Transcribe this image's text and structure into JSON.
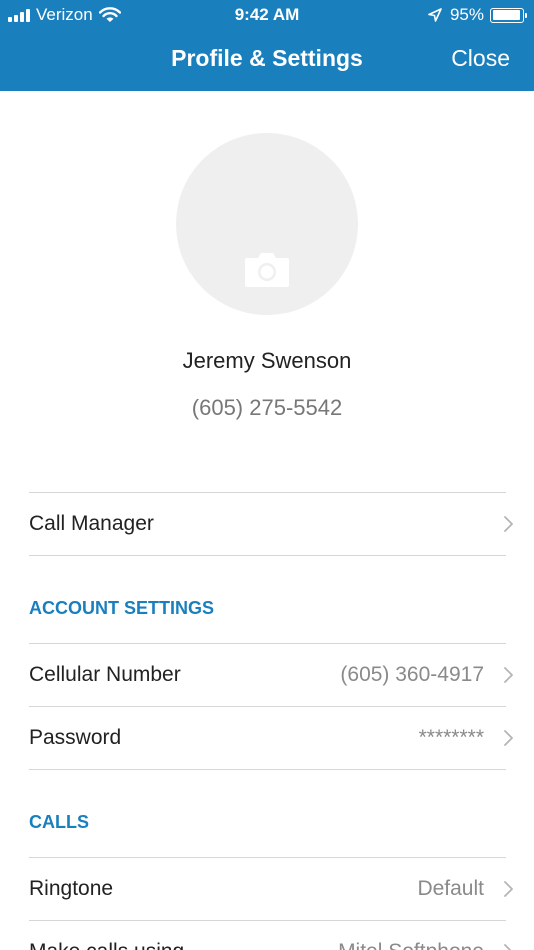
{
  "status_bar": {
    "carrier": "Verizon",
    "time": "9:42 AM",
    "battery": "95%",
    "battery_level": 0.95,
    "icons": [
      "signal-bars-icon",
      "wifi-icon",
      "location-arrow-icon",
      "battery-icon"
    ]
  },
  "nav": {
    "title": "Profile & Settings",
    "close_label": "Close"
  },
  "profile": {
    "name": "Jeremy Swenson",
    "phone": "(605) 275-5542",
    "avatar_icon": "camera-icon"
  },
  "rows": {
    "call_manager": {
      "label": "Call Manager"
    },
    "cellular_number": {
      "label": "Cellular Number",
      "value": "(605) 360-4917"
    },
    "password": {
      "label": "Password",
      "value": "********"
    },
    "ringtone": {
      "label": "Ringtone",
      "value": "Default"
    },
    "make_calls": {
      "label": "Make calls using",
      "value": "Mitel Softphone"
    }
  },
  "sections": {
    "account_settings": "ACCOUNT SETTINGS",
    "calls": "CALLS"
  },
  "colors": {
    "brand_blue": "#1a7fbd",
    "divider": "#d6d6d6",
    "secondary_text": "#8a8a8a"
  }
}
